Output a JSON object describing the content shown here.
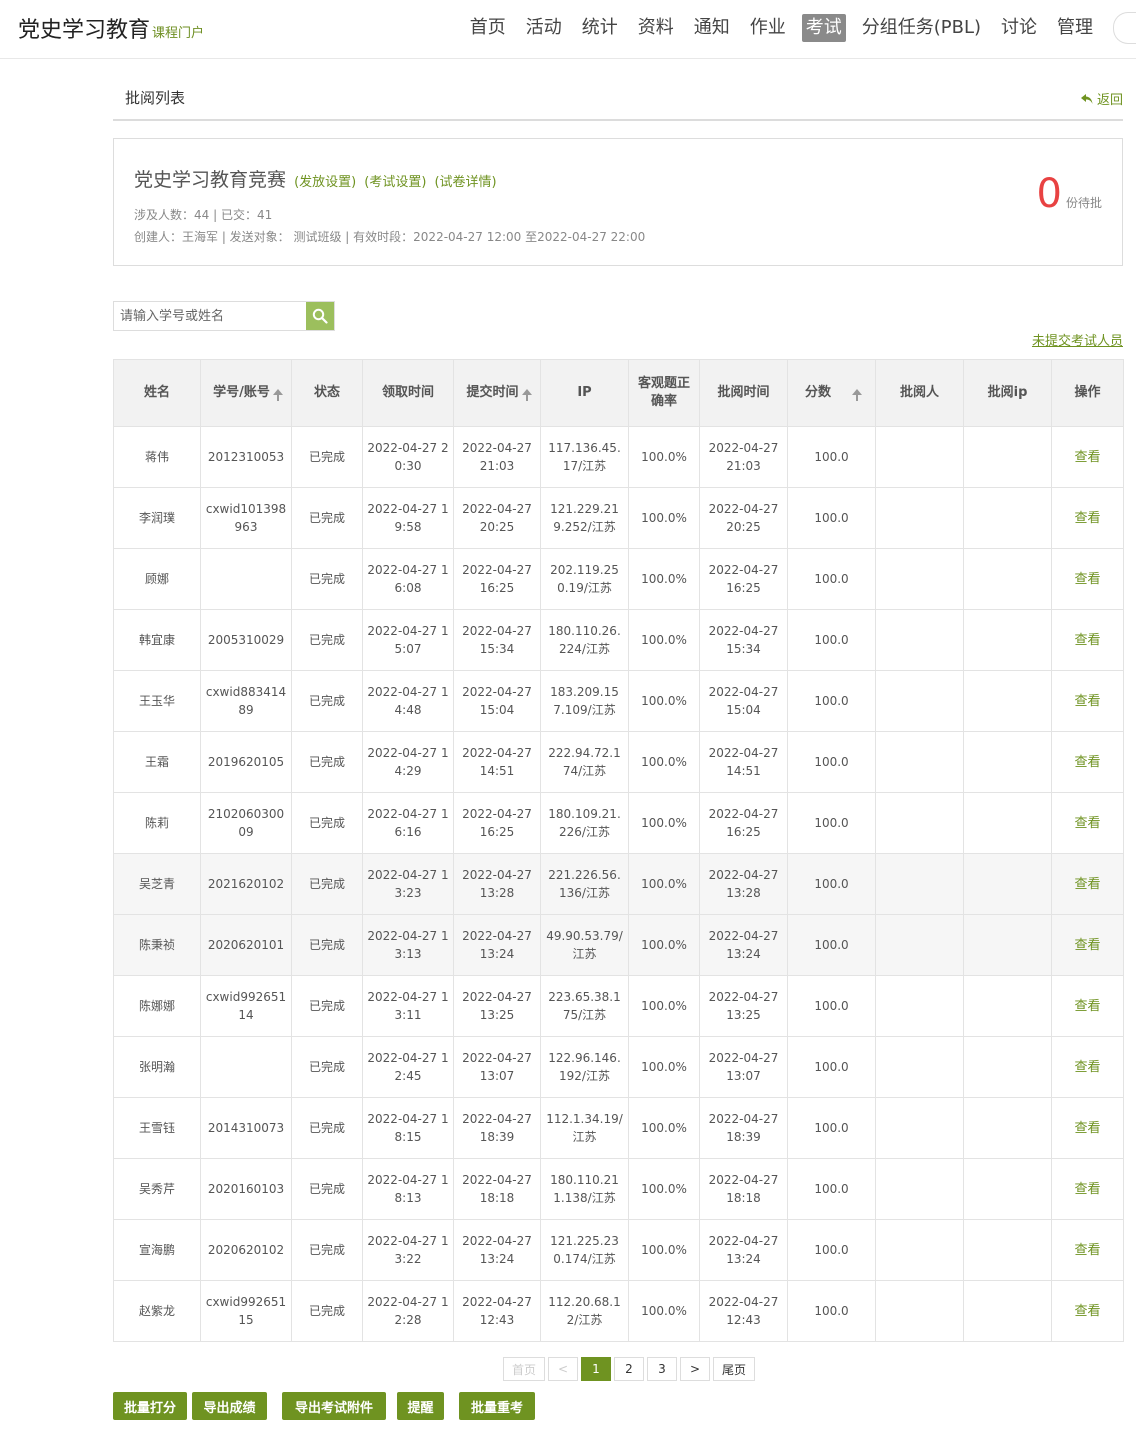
{
  "header": {
    "title": "党史学习教育",
    "subtitle": "课程门户",
    "nav": [
      "首页",
      "活动",
      "统计",
      "资料",
      "通知",
      "作业",
      "考试",
      "分组任务(PBL)",
      "讨论",
      "管理"
    ],
    "active_nav": "考试"
  },
  "breadcrumb": {
    "title": "批阅列表",
    "back": "返回"
  },
  "exam": {
    "name": "党史学习教育竞赛",
    "links": [
      "(发放设置)",
      "(考试设置)",
      "(试卷详情)"
    ],
    "stats": "涉及人数：44 | 已交：41",
    "meta": "创建人：王海军 | 发送对象： 测试班级  |  有效时段：2022-04-27 12:00 至2022-04-27 22:00",
    "pending_count": "0",
    "pending_label": "份待批"
  },
  "search": {
    "placeholder": "请输入学号或姓名",
    "value": ""
  },
  "unsubmitted_link": "未提交考试人员",
  "table": {
    "headers": [
      "姓名",
      "学号/账号",
      "状态",
      "领取时间",
      "提交时间",
      "IP",
      "客观题正确率",
      "批阅时间",
      "分数",
      "批阅人",
      "批阅ip",
      "操作"
    ],
    "rows": [
      {
        "name": "蒋伟",
        "id": "2012310053",
        "status": "已完成",
        "get_time": "2022-04-27 20:30",
        "submit_time": "2022-04-27 21:03",
        "ip": "117.136.45.17/江苏",
        "rate": "100.0%",
        "review_time": "2022-04-27 21:03",
        "score": "100.0",
        "reviewer": "",
        "review_ip": "",
        "action": "查看"
      },
      {
        "name": "李润璞",
        "id": "cxwid101398963",
        "status": "已完成",
        "get_time": "2022-04-27 19:58",
        "submit_time": "2022-04-27 20:25",
        "ip": "121.229.219.252/江苏",
        "rate": "100.0%",
        "review_time": "2022-04-27 20:25",
        "score": "100.0",
        "reviewer": "",
        "review_ip": "",
        "action": "查看"
      },
      {
        "name": "顾娜",
        "id": "",
        "status": "已完成",
        "get_time": "2022-04-27 16:08",
        "submit_time": "2022-04-27 16:25",
        "ip": "202.119.250.19/江苏",
        "rate": "100.0%",
        "review_time": "2022-04-27 16:25",
        "score": "100.0",
        "reviewer": "",
        "review_ip": "",
        "action": "查看"
      },
      {
        "name": "韩宜康",
        "id": "2005310029",
        "status": "已完成",
        "get_time": "2022-04-27 15:07",
        "submit_time": "2022-04-27 15:34",
        "ip": "180.110.26.224/江苏",
        "rate": "100.0%",
        "review_time": "2022-04-27 15:34",
        "score": "100.0",
        "reviewer": "",
        "review_ip": "",
        "action": "查看"
      },
      {
        "name": "王玉华",
        "id": "cxwid88341489",
        "status": "已完成",
        "get_time": "2022-04-27 14:48",
        "submit_time": "2022-04-27 15:04",
        "ip": "183.209.157.109/江苏",
        "rate": "100.0%",
        "review_time": "2022-04-27 15:04",
        "score": "100.0",
        "reviewer": "",
        "review_ip": "",
        "action": "查看"
      },
      {
        "name": "王霜",
        "id": "2019620105",
        "status": "已完成",
        "get_time": "2022-04-27 14:29",
        "submit_time": "2022-04-27 14:51",
        "ip": "222.94.72.174/江苏",
        "rate": "100.0%",
        "review_time": "2022-04-27 14:51",
        "score": "100.0",
        "reviewer": "",
        "review_ip": "",
        "action": "查看"
      },
      {
        "name": "陈莉",
        "id": "210206030009",
        "status": "已完成",
        "get_time": "2022-04-27 16:16",
        "submit_time": "2022-04-27 16:25",
        "ip": "180.109.21.226/江苏",
        "rate": "100.0%",
        "review_time": "2022-04-27 16:25",
        "score": "100.0",
        "reviewer": "",
        "review_ip": "",
        "action": "查看"
      },
      {
        "name": "吴芝青",
        "id": "2021620102",
        "status": "已完成",
        "get_time": "2022-04-27 13:23",
        "submit_time": "2022-04-27 13:28",
        "ip": "221.226.56.136/江苏",
        "rate": "100.0%",
        "review_time": "2022-04-27 13:28",
        "score": "100.0",
        "reviewer": "",
        "review_ip": "",
        "action": "查看"
      },
      {
        "name": "陈秉祯",
        "id": "2020620101",
        "status": "已完成",
        "get_time": "2022-04-27 13:13",
        "submit_time": "2022-04-27 13:24",
        "ip": "49.90.53.79/江苏",
        "rate": "100.0%",
        "review_time": "2022-04-27 13:24",
        "score": "100.0",
        "reviewer": "",
        "review_ip": "",
        "action": "查看"
      },
      {
        "name": "陈娜娜",
        "id": "cxwid99265114",
        "status": "已完成",
        "get_time": "2022-04-27 13:11",
        "submit_time": "2022-04-27 13:25",
        "ip": "223.65.38.175/江苏",
        "rate": "100.0%",
        "review_time": "2022-04-27 13:25",
        "score": "100.0",
        "reviewer": "",
        "review_ip": "",
        "action": "查看"
      },
      {
        "name": "张明瀚",
        "id": "",
        "status": "已完成",
        "get_time": "2022-04-27 12:45",
        "submit_time": "2022-04-27 13:07",
        "ip": "122.96.146.192/江苏",
        "rate": "100.0%",
        "review_time": "2022-04-27 13:07",
        "score": "100.0",
        "reviewer": "",
        "review_ip": "",
        "action": "查看"
      },
      {
        "name": "王雪钰",
        "id": "2014310073",
        "status": "已完成",
        "get_time": "2022-04-27 18:15",
        "submit_time": "2022-04-27 18:39",
        "ip": "112.1.34.19/江苏",
        "rate": "100.0%",
        "review_time": "2022-04-27 18:39",
        "score": "100.0",
        "reviewer": "",
        "review_ip": "",
        "action": "查看"
      },
      {
        "name": "吴秀芹",
        "id": "2020160103",
        "status": "已完成",
        "get_time": "2022-04-27 18:13",
        "submit_time": "2022-04-27 18:18",
        "ip": "180.110.211.138/江苏",
        "rate": "100.0%",
        "review_time": "2022-04-27 18:18",
        "score": "100.0",
        "reviewer": "",
        "review_ip": "",
        "action": "查看"
      },
      {
        "name": "宣海鹏",
        "id": "2020620102",
        "status": "已完成",
        "get_time": "2022-04-27 13:22",
        "submit_time": "2022-04-27 13:24",
        "ip": "121.225.230.174/江苏",
        "rate": "100.0%",
        "review_time": "2022-04-27 13:24",
        "score": "100.0",
        "reviewer": "",
        "review_ip": "",
        "action": "查看"
      },
      {
        "name": "赵紫龙",
        "id": "cxwid99265115",
        "status": "已完成",
        "get_time": "2022-04-27 12:28",
        "submit_time": "2022-04-27 12:43",
        "ip": "112.20.68.12/江苏",
        "rate": "100.0%",
        "review_time": "2022-04-27 12:43",
        "score": "100.0",
        "reviewer": "",
        "review_ip": "",
        "action": "查看"
      }
    ]
  },
  "pagination": {
    "first": "首页",
    "prev": "<",
    "pages": [
      "1",
      "2",
      "3"
    ],
    "current": "1",
    "next": ">",
    "last": "尾页"
  },
  "actions": [
    "批量打分",
    "导出成绩",
    "导出考试附件",
    "提醒",
    "批量重考"
  ],
  "colors": {
    "accent": "#6f9321",
    "pending": "#e84242",
    "search_button": "#9cbf5d",
    "active_nav": "#8a8a8a"
  },
  "icons": {
    "search": "search-icon",
    "back": "back-arrow-icon",
    "sort": "sort-up-icon"
  }
}
